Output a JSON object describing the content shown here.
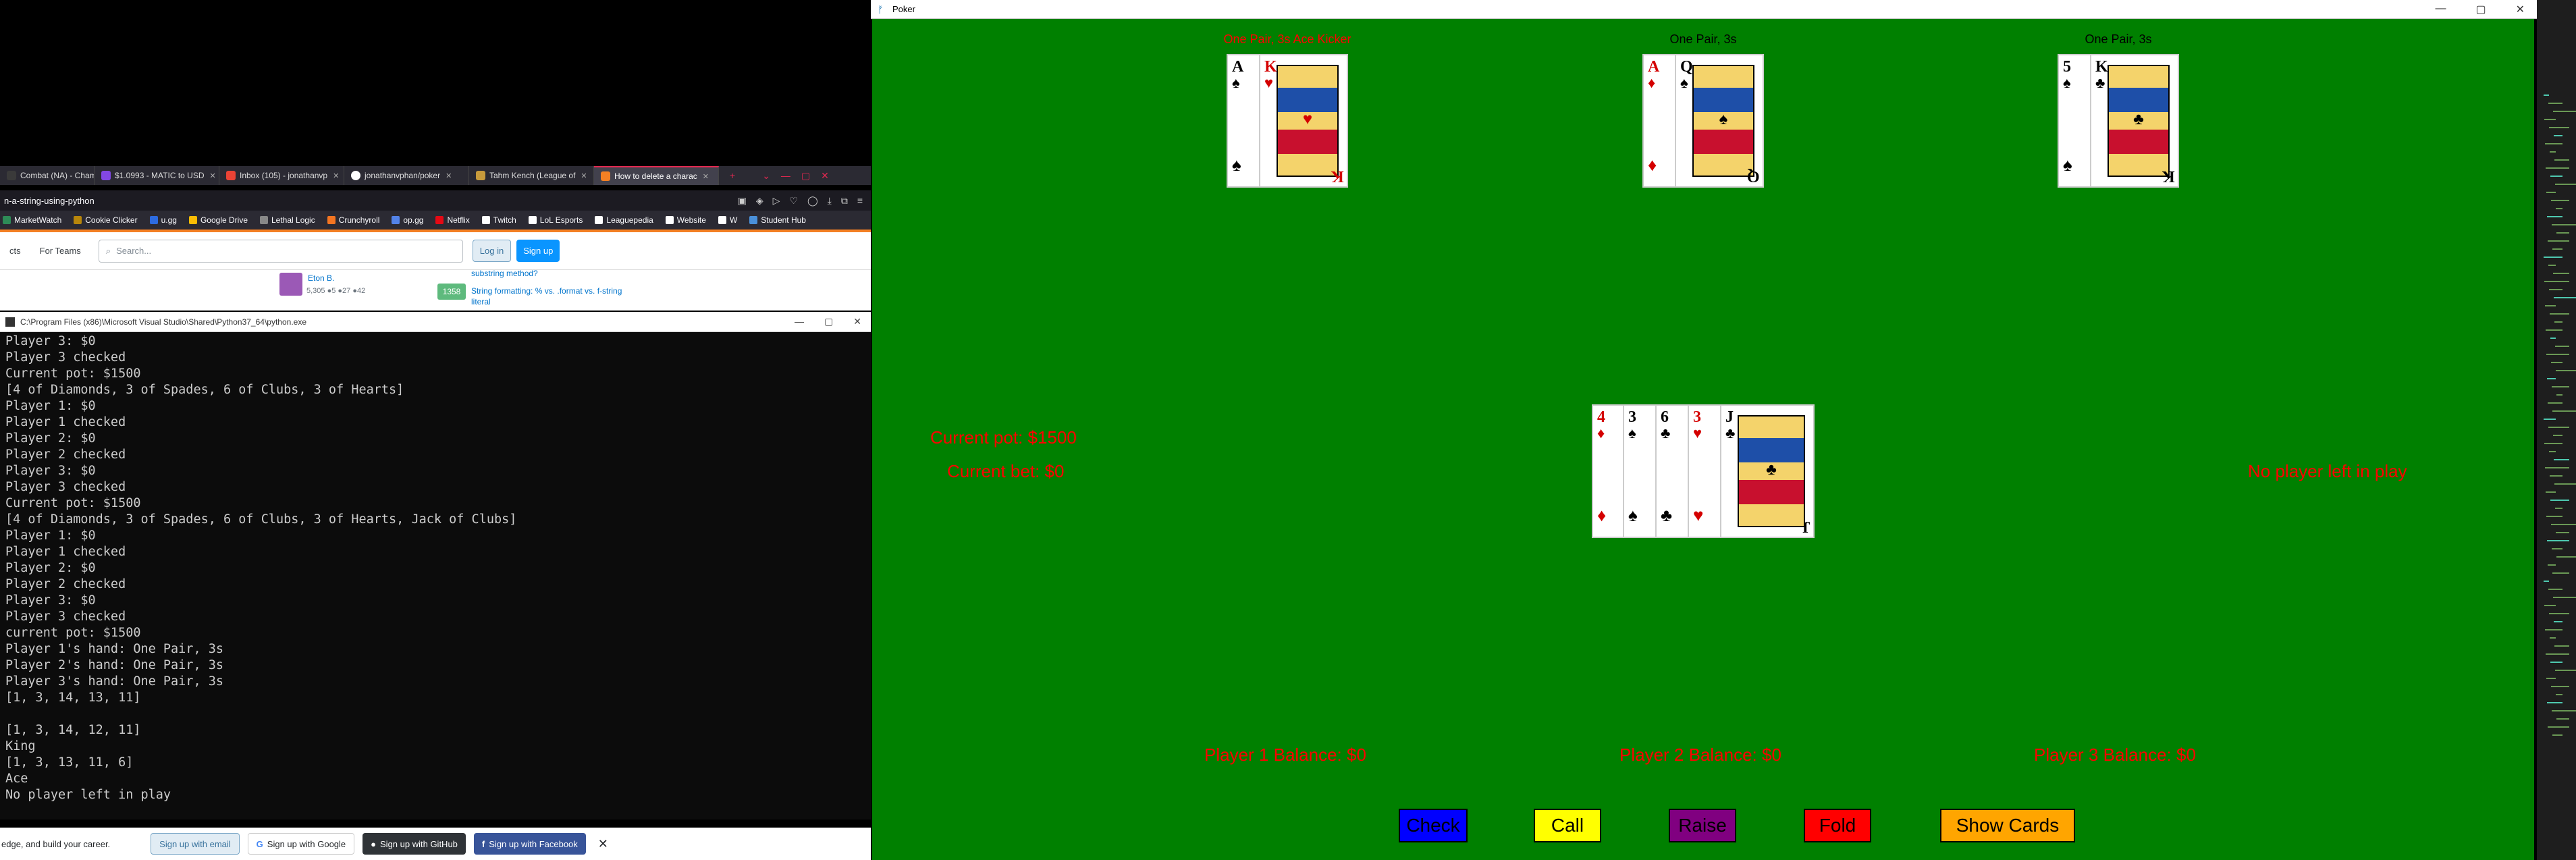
{
  "browser": {
    "tabs": [
      {
        "label": "Combat (NA) - Champ",
        "color": "#3a3a3a"
      },
      {
        "label": "$1.0993 - MATIC to USD",
        "color": "#8247e5"
      },
      {
        "label": "Inbox (105) - jonathanvp",
        "color": "#ea4335"
      },
      {
        "label": "jonathanvphan/poker",
        "color": "#ffffff"
      },
      {
        "label": "Tahm Kench (League of",
        "color": "#c89b3c"
      },
      {
        "label": "How to delete a charac",
        "color": "#f48024"
      }
    ],
    "url": "n-a-string-using-python",
    "bookmarks": [
      {
        "label": "MarketWatch",
        "color": "#2e8b57"
      },
      {
        "label": "Cookie Clicker",
        "color": "#b8860b"
      },
      {
        "label": "u.gg",
        "color": "#2d6be0"
      },
      {
        "label": "Google Drive",
        "color": "#fbbc04"
      },
      {
        "label": "Lethal Logic",
        "color": "#888"
      },
      {
        "label": "Crunchyroll",
        "color": "#f47521"
      },
      {
        "label": "op.gg",
        "color": "#5383e8"
      },
      {
        "label": "Netflix",
        "color": "#e50914"
      },
      {
        "label": "Twitch",
        "color": "#ffffff"
      },
      {
        "label": "LoL Esports",
        "color": "#ffffff"
      },
      {
        "label": "Leaguepedia",
        "color": "#ffffff"
      },
      {
        "label": "Website",
        "color": "#ffffff"
      },
      {
        "label": "W",
        "color": "#ffffff"
      },
      {
        "label": "Student Hub",
        "color": "#4a90d9"
      }
    ],
    "so": {
      "nav_products": "cts",
      "nav_teams": "For Teams",
      "search_placeholder": "Search...",
      "login": "Log in",
      "signup": "Sign up",
      "user_name": "Eton B.",
      "user_stats": "5,305 ●5 ●27 ●42",
      "answer_count": "1358",
      "link1": "substring method?",
      "link2": "String formatting: % vs. .format vs. f-string",
      "link3": "literal",
      "bottom_text": "edge, and build your career.",
      "signup_email": "Sign up with email",
      "signup_google": "Sign up with Google",
      "signup_github": "Sign up with GitHub",
      "signup_facebook": "Sign up with Facebook"
    },
    "console": {
      "title": "C:\\Program Files (x86)\\Microsoft Visual Studio\\Shared\\Python37_64\\python.exe",
      "lines": [
        "Player 3: $0",
        "Player 3 checked",
        "Current pot: $1500",
        "[4 of Diamonds, 3 of Spades, 6 of Clubs, 3 of Hearts]",
        "Player 1: $0",
        "Player 1 checked",
        "Player 2: $0",
        "Player 2 checked",
        "Player 3: $0",
        "Player 3 checked",
        "Current pot: $1500",
        "[4 of Diamonds, 3 of Spades, 6 of Clubs, 3 of Hearts, Jack of Clubs]",
        "Player 1: $0",
        "Player 1 checked",
        "Player 2: $0",
        "Player 2 checked",
        "Player 3: $0",
        "Player 3 checked",
        "current pot: $1500",
        "Player 1's hand: One Pair, 3s",
        "Player 2's hand: One Pair, 3s",
        "Player 3's hand: One Pair, 3s",
        "[1, 3, 14, 13, 11]",
        "",
        "[1, 3, 14, 12, 11]",
        "King",
        "[1, 3, 13, 11, 6]",
        "Ace",
        "No player left in play"
      ]
    }
  },
  "poker": {
    "title": "Poker",
    "hands": [
      {
        "label": "One Pair, 3s Ace Kicker",
        "label_color": "#ff0000",
        "cards": [
          {
            "rank": "A",
            "suit": "♠",
            "color": "black"
          },
          {
            "rank": "K",
            "suit": "♥",
            "color": "red"
          }
        ]
      },
      {
        "label": "One Pair, 3s",
        "label_color": "#000000",
        "cards": [
          {
            "rank": "A",
            "suit": "♦",
            "color": "red"
          },
          {
            "rank": "Q",
            "suit": "♠",
            "color": "black"
          }
        ]
      },
      {
        "label": "One Pair, 3s",
        "label_color": "#000000",
        "cards": [
          {
            "rank": "5",
            "suit": "♠",
            "color": "black"
          },
          {
            "rank": "K",
            "suit": "♣",
            "color": "black"
          }
        ]
      }
    ],
    "community": [
      {
        "rank": "4",
        "suit": "♦",
        "color": "red"
      },
      {
        "rank": "3",
        "suit": "♠",
        "color": "black"
      },
      {
        "rank": "6",
        "suit": "♣",
        "color": "black"
      },
      {
        "rank": "3",
        "suit": "♥",
        "color": "red"
      },
      {
        "rank": "J",
        "suit": "♣",
        "color": "black"
      }
    ],
    "pot": "Current pot: $1500",
    "bet": "Current bet: $0",
    "status": "No player left in play",
    "balances": [
      "Player 1 Balance: $0",
      "Player 2 Balance: $0",
      "Player 3 Balance: $0"
    ],
    "buttons": [
      {
        "label": "Check",
        "color": "#0000ff"
      },
      {
        "label": "Call",
        "color": "#ffff00"
      },
      {
        "label": "Raise",
        "color": "#800080"
      },
      {
        "label": "Fold",
        "color": "#ff0000"
      },
      {
        "label": "Show Cards",
        "color": "#ffa500"
      }
    ],
    "felt_color": "#008000",
    "text_color": "#ff0000"
  }
}
